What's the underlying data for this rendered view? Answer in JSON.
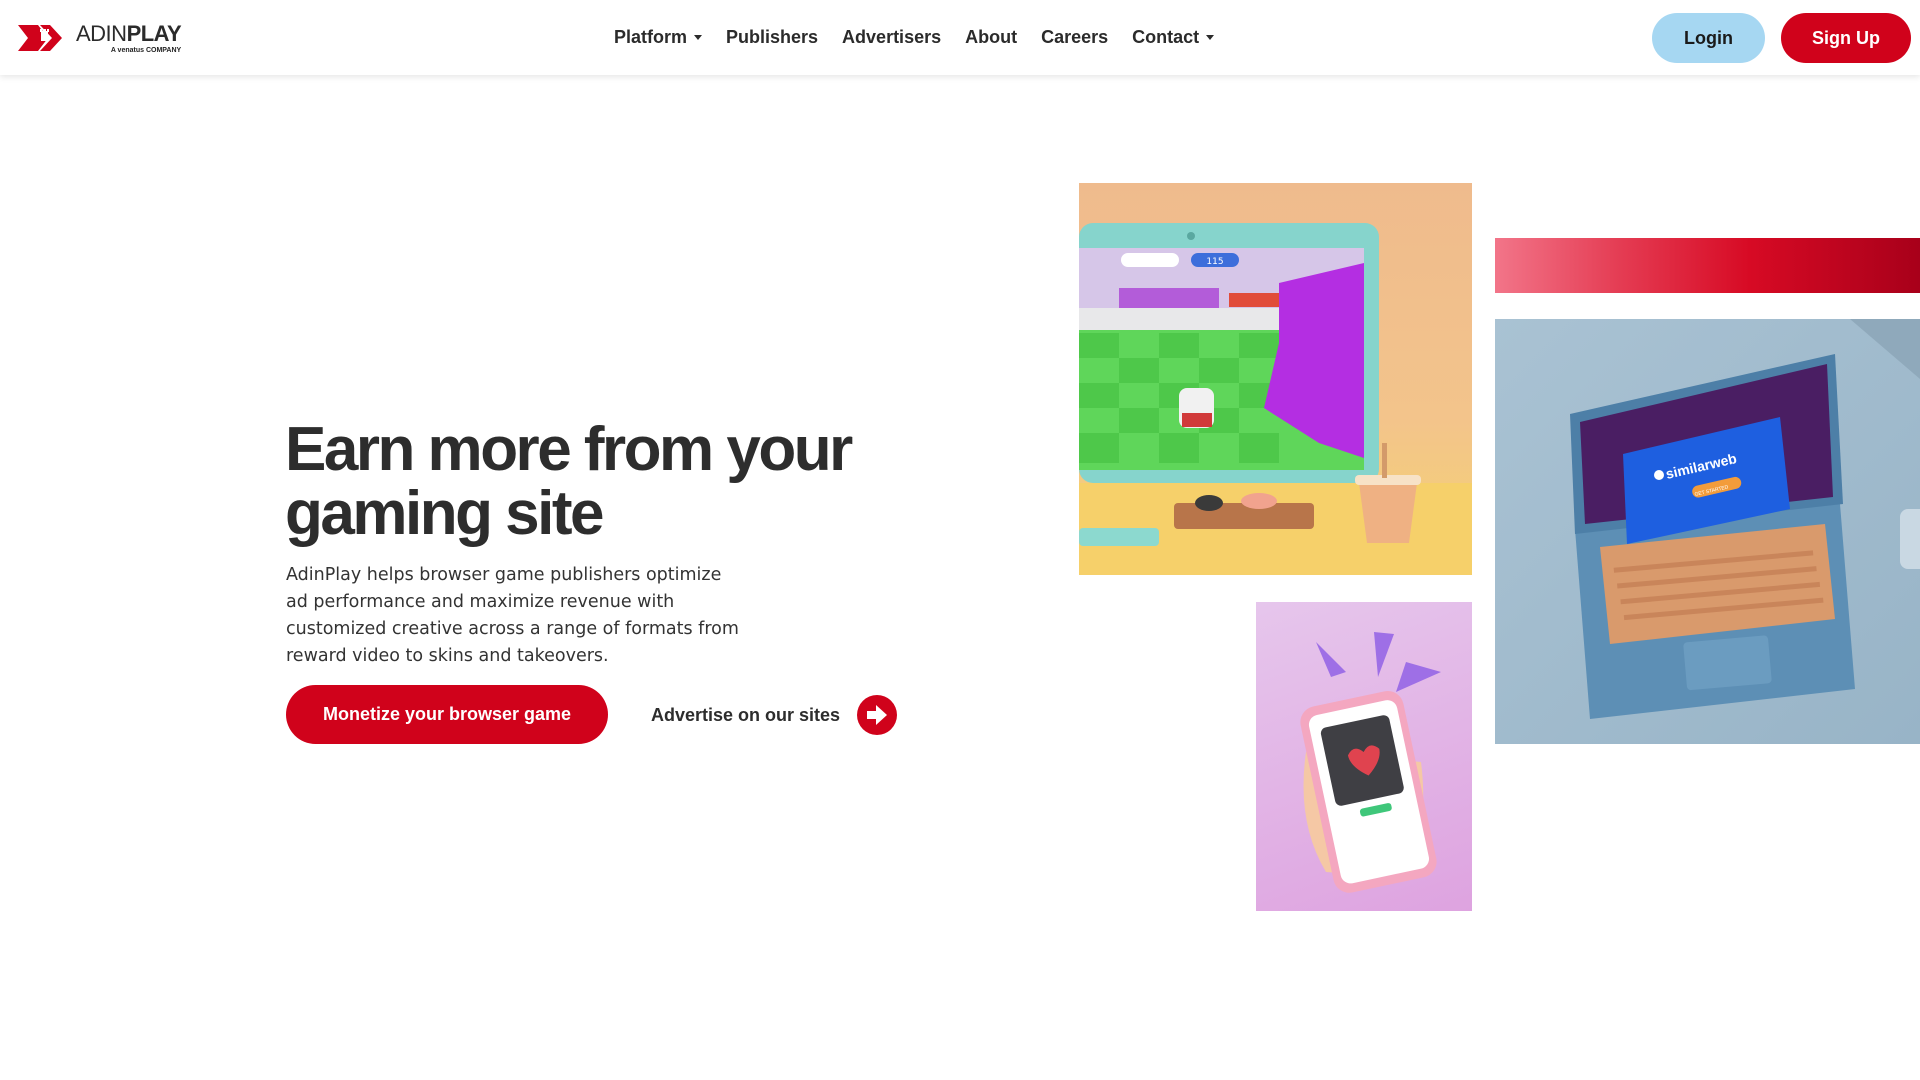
{
  "header": {
    "logo_main_light": "ADIN",
    "logo_main_bold": "PLAY",
    "logo_sub": "A venatus COMPANY",
    "nav": [
      {
        "label": "Platform",
        "has_dropdown": true
      },
      {
        "label": "Publishers",
        "has_dropdown": false
      },
      {
        "label": "Advertisers",
        "has_dropdown": false
      },
      {
        "label": "About",
        "has_dropdown": false
      },
      {
        "label": "Careers",
        "has_dropdown": false
      },
      {
        "label": "Contact",
        "has_dropdown": true
      }
    ],
    "login_label": "Login",
    "signup_label": "Sign Up"
  },
  "hero": {
    "title_line1": "Earn more from your",
    "title_line2": "gaming site",
    "description": "AdinPlay helps browser game publishers optimize ad performance and maximize revenue with customized creative across a range of formats from reward video to skins and takeovers.",
    "primary_button": "Monetize your browser game",
    "secondary_link": "Advertise on our sites"
  },
  "images": {
    "laptop_brand": "similarweb",
    "laptop_cta": "GET STARTED",
    "game_timer": "115"
  },
  "colors": {
    "brand_red": "#d0021b",
    "login_blue": "#a6d7f2",
    "text_dark": "#2d2d2d"
  }
}
